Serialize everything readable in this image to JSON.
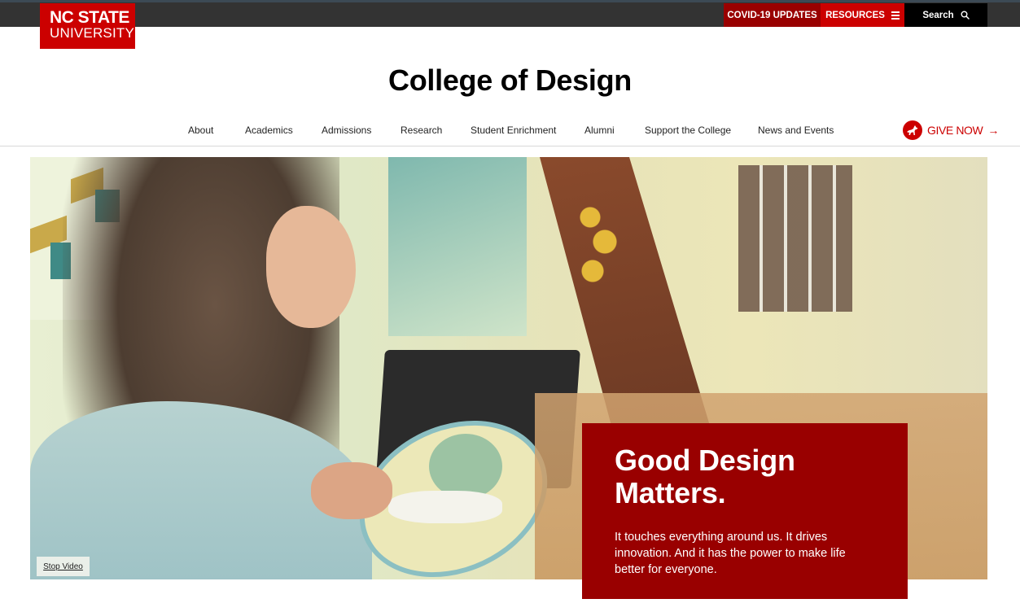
{
  "brand": {
    "line1": "NC STATE",
    "line2": "UNIVERSITY",
    "color": "#cc0000"
  },
  "utility_nav": {
    "covid_label": "COVID-19 UPDATES",
    "resources_label": "RESOURCES",
    "resources_icon": "hamburger-menu-icon",
    "search_label": "Search",
    "search_icon": "magnifier-icon",
    "colors": {
      "covid": "#990000",
      "resources": "#cc0000",
      "search": "#000000"
    }
  },
  "site_title": "College of Design",
  "main_nav": {
    "items": [
      {
        "label": "About"
      },
      {
        "label": "Academics"
      },
      {
        "label": "Admissions"
      },
      {
        "label": "Research"
      },
      {
        "label": "Student Enrichment"
      },
      {
        "label": "Alumni"
      },
      {
        "label": "Support the College"
      },
      {
        "label": "News and Events"
      }
    ],
    "give": {
      "label": "GIVE NOW",
      "arrow": "→",
      "icon": "wolf-icon"
    }
  },
  "hero": {
    "media": "video-student-working-on-textile",
    "stop_video_label": "Stop Video",
    "callout": {
      "heading_line1": "Good Design",
      "heading_line2": "Matters.",
      "body": "It touches everything around us. It drives innovation. And it has the power to make life better for everyone.",
      "color": "#990000"
    }
  }
}
